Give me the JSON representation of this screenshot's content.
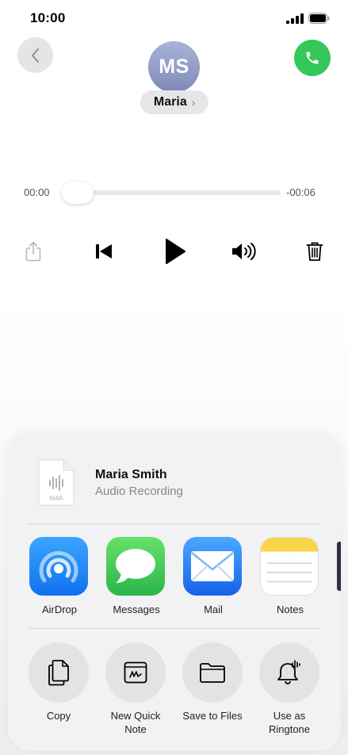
{
  "status_bar": {
    "time": "10:00"
  },
  "contact": {
    "initials": "MS",
    "name": "Maria",
    "chevron": "›"
  },
  "player": {
    "elapsed": "00:00",
    "remaining": "-00:06",
    "progress": 0.0
  },
  "controls": [
    {
      "name": "share-icon"
    },
    {
      "name": "skip-back-icon"
    },
    {
      "name": "play-icon"
    },
    {
      "name": "speaker-icon"
    },
    {
      "name": "trash-icon"
    }
  ],
  "share_sheet": {
    "title": "Maria Smith",
    "subtitle": "Audio Recording",
    "file_type": "M4A",
    "apps": [
      {
        "label": "AirDrop",
        "icon": "airdrop-icon",
        "color": "#1a8cff"
      },
      {
        "label": "Messages",
        "icon": "messages-icon",
        "color": "#34c759"
      },
      {
        "label": "Mail",
        "icon": "mail-icon",
        "color": "#1e7cf0"
      },
      {
        "label": "Notes",
        "icon": "notes-icon",
        "color": "#f8d548"
      }
    ],
    "actions": [
      {
        "label": "Copy",
        "icon": "copy-icon"
      },
      {
        "label": "New Quick Note",
        "icon": "quick-note-icon"
      },
      {
        "label": "Save to Files",
        "icon": "folder-icon"
      },
      {
        "label": "Use as Ringtone",
        "icon": "ringtone-bell-icon"
      }
    ]
  },
  "colors": {
    "call_green": "#34c759",
    "avatar": "#8f99c6",
    "sheet_bg": "#f2f2f4"
  }
}
